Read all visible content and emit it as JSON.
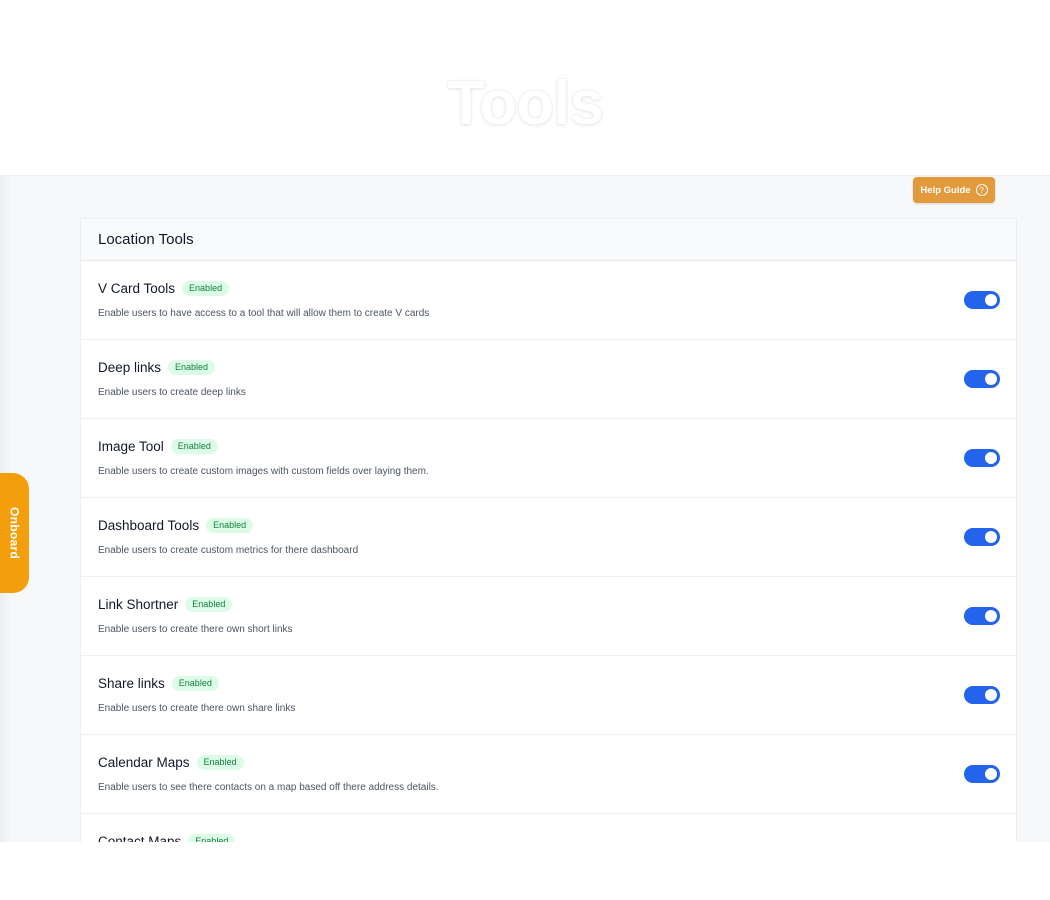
{
  "header": {
    "title": "Tools"
  },
  "help_guide": {
    "label": "Help Guide",
    "icon": "?"
  },
  "onboard": {
    "label": "Onboard"
  },
  "card": {
    "title": "Location Tools"
  },
  "colors": {
    "accent": "#2463eb",
    "badge_bg": "#dcfce7",
    "badge_text": "#15803d",
    "help": "#e29a3c",
    "onboard": "#f59e0b"
  },
  "tools": [
    {
      "title": "V Card Tools",
      "badge": "Enabled",
      "description": "Enable users to have access to a tool that will allow them to create V cards",
      "enabled": true
    },
    {
      "title": "Deep links",
      "badge": "Enabled",
      "description": "Enable users to create deep links",
      "enabled": true
    },
    {
      "title": "Image Tool",
      "badge": "Enabled",
      "description": "Enable users to create custom images with custom fields over laying them.",
      "enabled": true
    },
    {
      "title": "Dashboard Tools",
      "badge": "Enabled",
      "description": "Enable users to create custom metrics for there dashboard",
      "enabled": true
    },
    {
      "title": "Link Shortner",
      "badge": "Enabled",
      "description": "Enable users to create there own short links",
      "enabled": true
    },
    {
      "title": "Share links",
      "badge": "Enabled",
      "description": "Enable users to create there own share links",
      "enabled": true
    },
    {
      "title": "Calendar Maps",
      "badge": "Enabled",
      "description": "Enable users to see there contacts on a map based off there address details.",
      "enabled": true
    },
    {
      "title": "Contact Maps",
      "badge": "Enabled",
      "description": "",
      "enabled": true
    }
  ]
}
